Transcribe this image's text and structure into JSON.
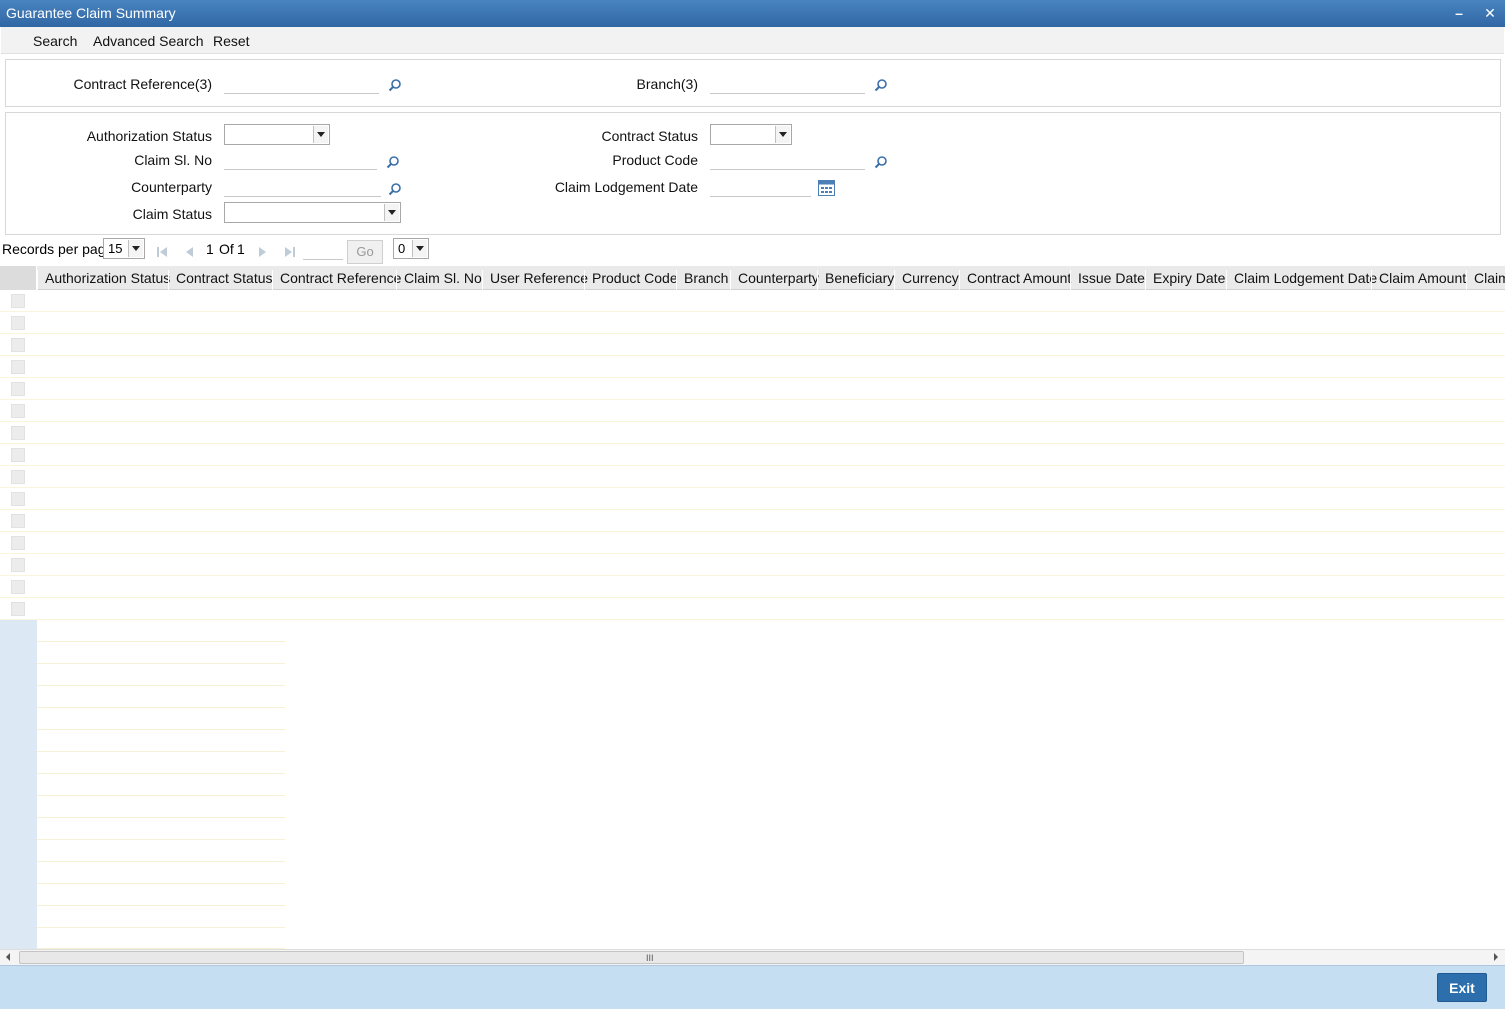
{
  "window": {
    "title": "Guarantee Claim Summary",
    "minimize": "–",
    "close": "✕"
  },
  "toolbar": {
    "search": "Search",
    "advanced_search": "Advanced Search",
    "reset": "Reset"
  },
  "query": {
    "contract_reference_label": "Contract Reference(3)",
    "contract_reference_value": "",
    "branch_label": "Branch(3)",
    "branch_value": ""
  },
  "filters": {
    "authorization_status_label": "Authorization Status",
    "authorization_status_value": "",
    "contract_status_label": "Contract Status",
    "contract_status_value": "",
    "claim_sl_no_label": "Claim Sl. No",
    "claim_sl_no_value": "",
    "product_code_label": "Product Code",
    "product_code_value": "",
    "counterparty_label": "Counterparty",
    "counterparty_value": "",
    "claim_lodgement_date_label": "Claim Lodgement Date",
    "claim_lodgement_date_value": "",
    "claim_status_label": "Claim Status",
    "claim_status_value": ""
  },
  "pager": {
    "records_per_page_label": "Records per page",
    "records_per_page_value": "15",
    "page_current": "1",
    "page_of": "Of",
    "page_total": "1",
    "goto_value": "",
    "go_label": "Go",
    "extra_select_value": "0"
  },
  "grid": {
    "columns": [
      "Authorization Status",
      "Contract Status",
      "Contract Reference",
      "Claim Sl. No",
      "User Reference",
      "Product Code",
      "Branch",
      "Counterparty",
      "Beneficiary",
      "Currency",
      "Contract Amount",
      "Issue Date",
      "Expiry Date",
      "Claim Lodgement Date",
      "Claim Amount",
      "Claim"
    ],
    "rows": 15
  },
  "footer": {
    "exit_label": "Exit"
  },
  "icons": {
    "lookup": "magnifier-icon",
    "calendar": "calendar-icon",
    "dropdown": "chevron-down-icon"
  },
  "colors": {
    "titlebar": "#2f67a4",
    "footer": "#c5def1",
    "exit_button": "#2d6fad"
  }
}
